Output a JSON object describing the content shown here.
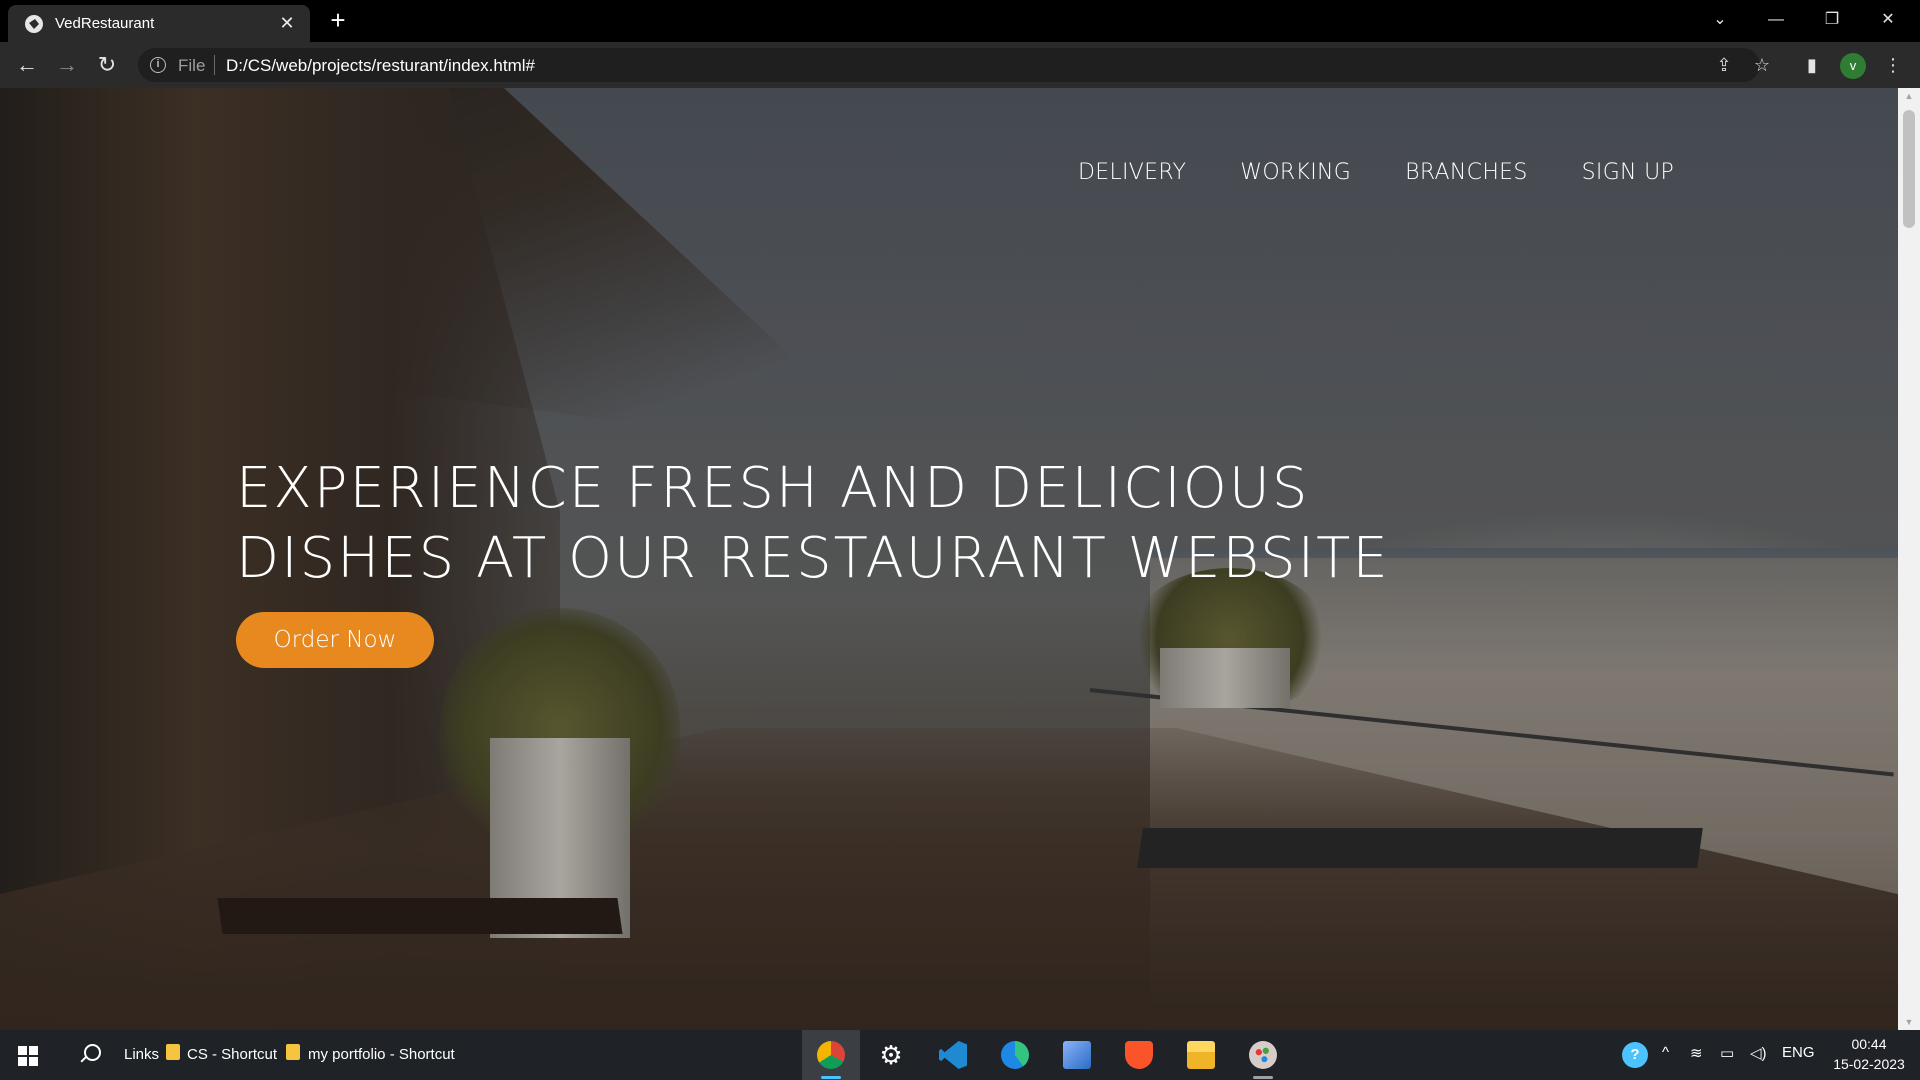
{
  "browser": {
    "tab_title": "VedRestaurant",
    "tab_close": "✕",
    "new_tab": "+",
    "omnibox_scheme": "File",
    "omnibox_url": "D:/CS/web/projects/resturant/index.html#",
    "profile_initial": "v",
    "window_controls": [
      "chevron-down",
      "minimize",
      "restore",
      "close"
    ]
  },
  "page": {
    "nav": [
      "DELIVERY",
      "WORKING",
      "BRANCHES",
      "SIGN UP"
    ],
    "hero_line1": "EXPERIENCE FRESH AND DELICIOUS",
    "hero_line2": "DISHES AT OUR RESTAURANT WEBSITE",
    "cta_label": "Order Now",
    "accent_color": "#e8891f"
  },
  "taskbar": {
    "links_label": "Links",
    "shortcuts": [
      "CS - Shortcut",
      "my portfolio - Shortcut"
    ],
    "apps": [
      "chrome",
      "settings",
      "vscode",
      "edge",
      "remote-desktop",
      "brave",
      "file-explorer",
      "paint"
    ],
    "language": "ENG",
    "time": "00:44",
    "date": "15-02-2023"
  }
}
